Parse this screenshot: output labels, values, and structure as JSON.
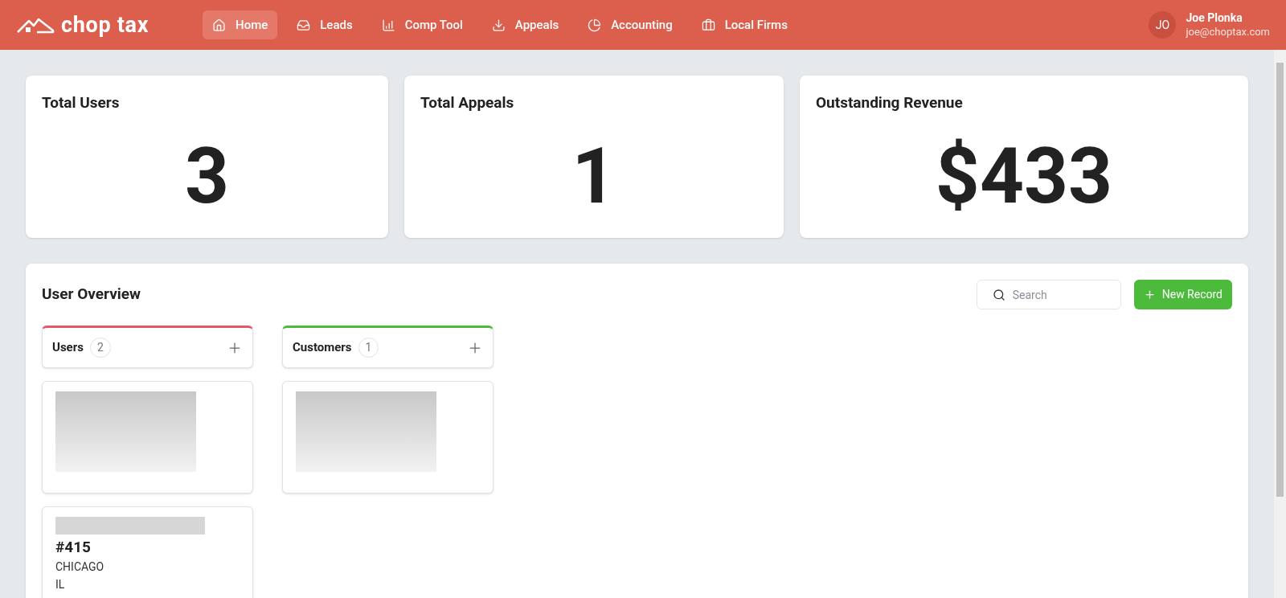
{
  "brand": {
    "name": "chop tax"
  },
  "nav": [
    {
      "label": "Home",
      "kind": "home",
      "selected": true
    },
    {
      "label": "Leads",
      "kind": "inbox",
      "selected": false
    },
    {
      "label": "Comp Tool",
      "kind": "chart",
      "selected": false
    },
    {
      "label": "Appeals",
      "kind": "download",
      "selected": false
    },
    {
      "label": "Accounting",
      "kind": "pie",
      "selected": false
    },
    {
      "label": "Local Firms",
      "kind": "briefcase",
      "selected": false
    }
  ],
  "user": {
    "initials": "JO",
    "name": "Joe Plonka",
    "email": "joe@choptax.com"
  },
  "stats": [
    {
      "title": "Total Users",
      "value": "3"
    },
    {
      "title": "Total Appeals",
      "value": "1"
    },
    {
      "title": "Outstanding Revenue",
      "value": "$433"
    }
  ],
  "overview": {
    "title": "User Overview",
    "search": {
      "placeholder": "Search"
    },
    "new_button": "New Record",
    "columns": [
      {
        "title": "Users",
        "count": "2",
        "color": "#e05a6a",
        "cards": [
          {
            "kind": "redacted"
          },
          {
            "kind": "address",
            "heading": "#415",
            "lines": [
              "CHICAGO",
              "IL"
            ]
          }
        ]
      },
      {
        "title": "Customers",
        "count": "1",
        "color": "#4cbb3c",
        "cards": [
          {
            "kind": "redacted"
          }
        ]
      }
    ]
  }
}
